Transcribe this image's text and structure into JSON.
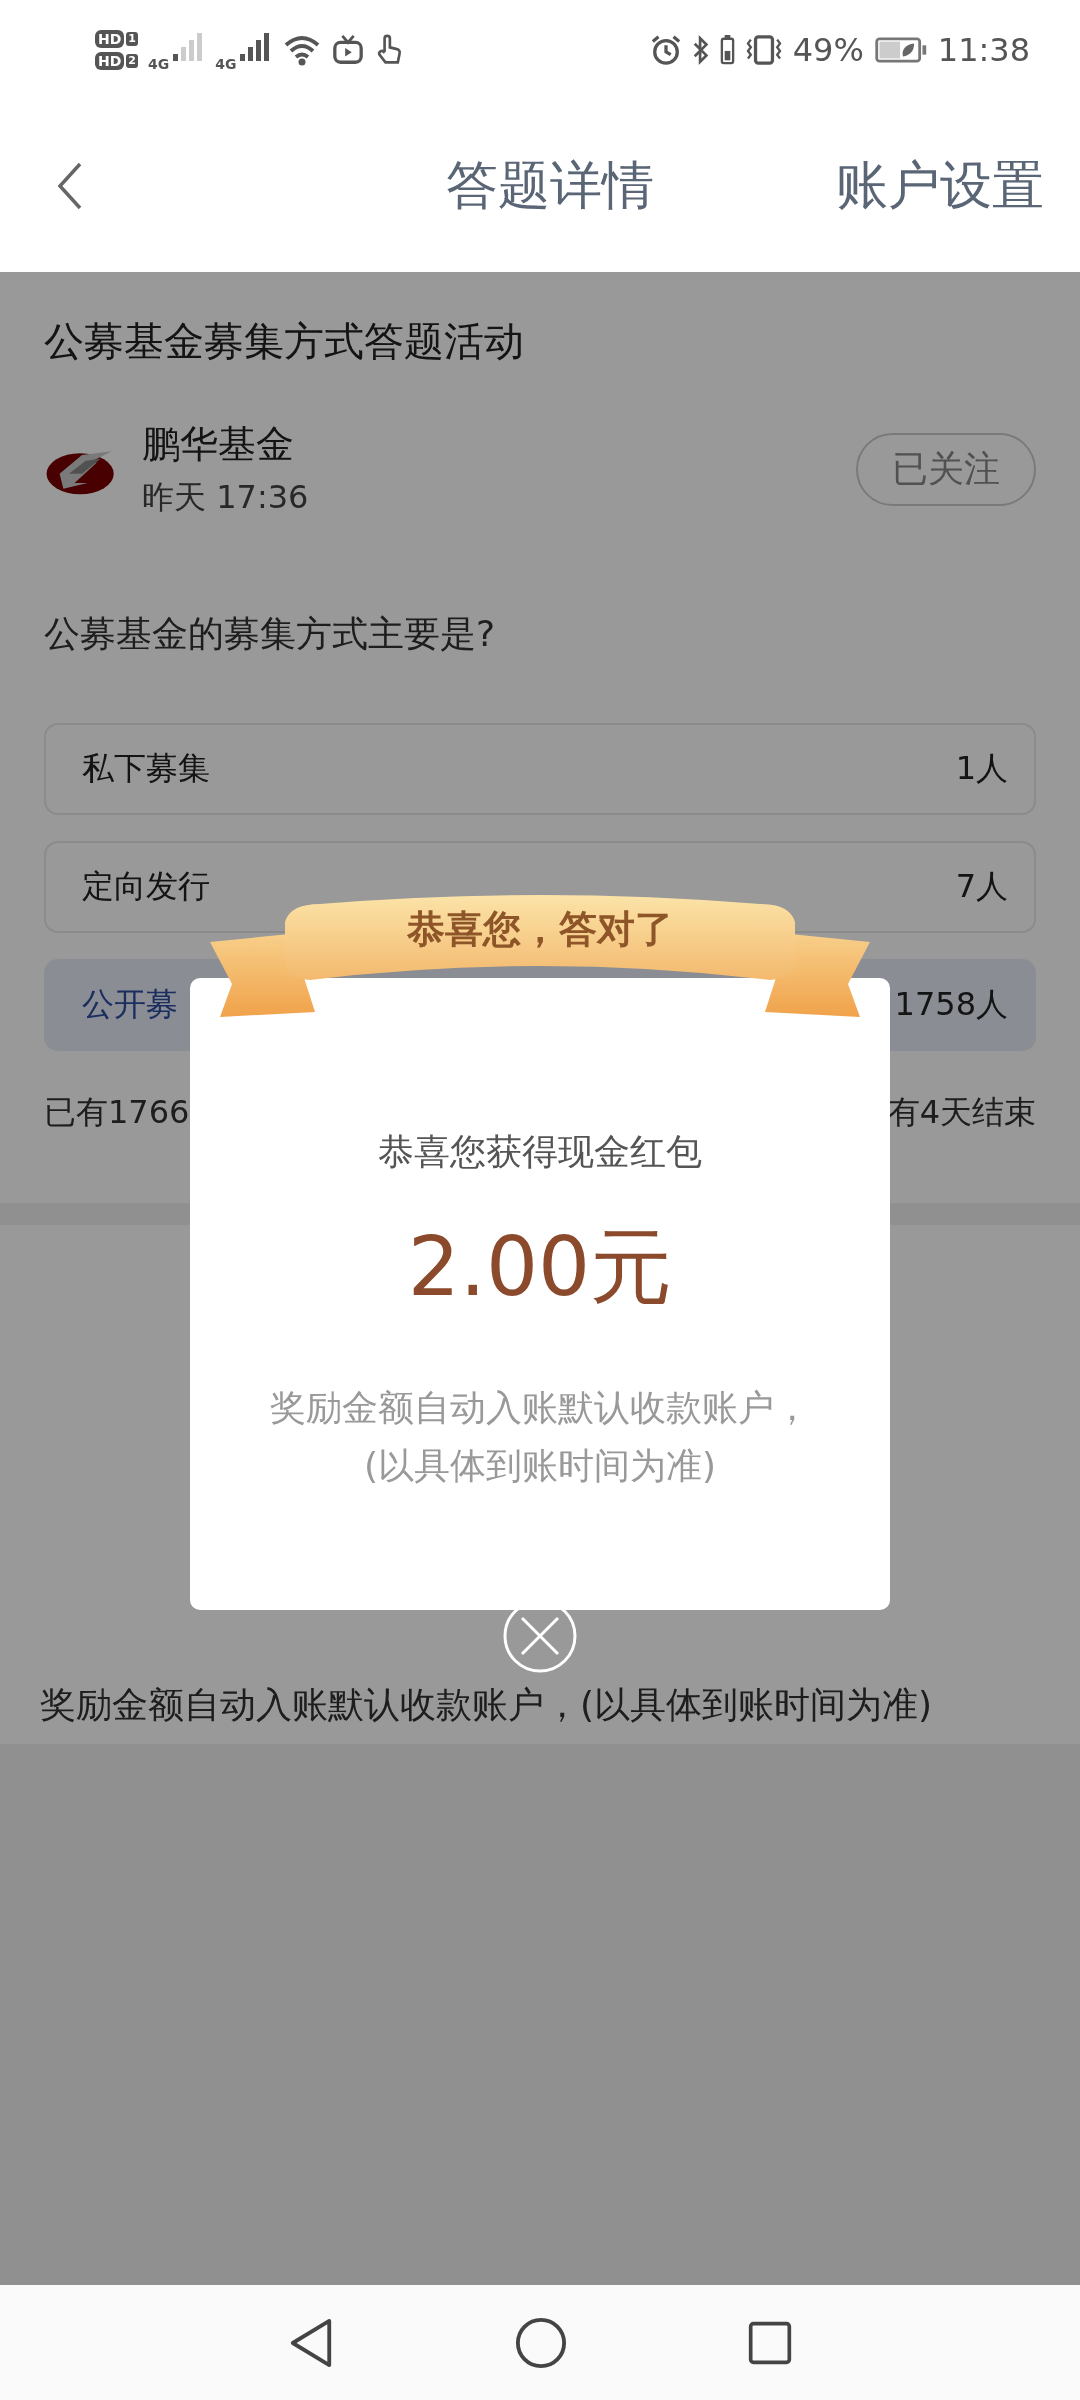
{
  "status_bar": {
    "sims": [
      {
        "label": "HD",
        "slot": "1"
      },
      {
        "label": "HD",
        "slot": "2"
      }
    ],
    "networks": [
      "4G",
      "4G"
    ],
    "battery_percent": "49%",
    "time": "11:38"
  },
  "header": {
    "title": "答题详情",
    "action": "账户设置"
  },
  "activity": {
    "title": "公募基金募集方式答题活动",
    "publisher": {
      "name": "鹏华基金",
      "time": "昨天 17:36",
      "follow_label": "已关注"
    },
    "question": "公募基金的募集方式主要是?",
    "options": [
      {
        "label": "私下募集",
        "count": "1人",
        "selected": false
      },
      {
        "label": "定向发行",
        "count": "7人",
        "selected": false
      },
      {
        "label": "公开募",
        "count": "1758人",
        "selected": true
      }
    ],
    "stats_left": "已有1766",
    "stats_right": "有4天结束"
  },
  "notice": "奖励金额自动入账默认收款账户，(以具体到账时间为准)",
  "popup": {
    "banner": "恭喜您，答对了",
    "subtitle": "恭喜您获得现金红包",
    "amount": "2.00元",
    "note_lines": [
      "奖励金额自动入账默认收款账户，",
      "(以具体到账时间为准)"
    ]
  }
}
